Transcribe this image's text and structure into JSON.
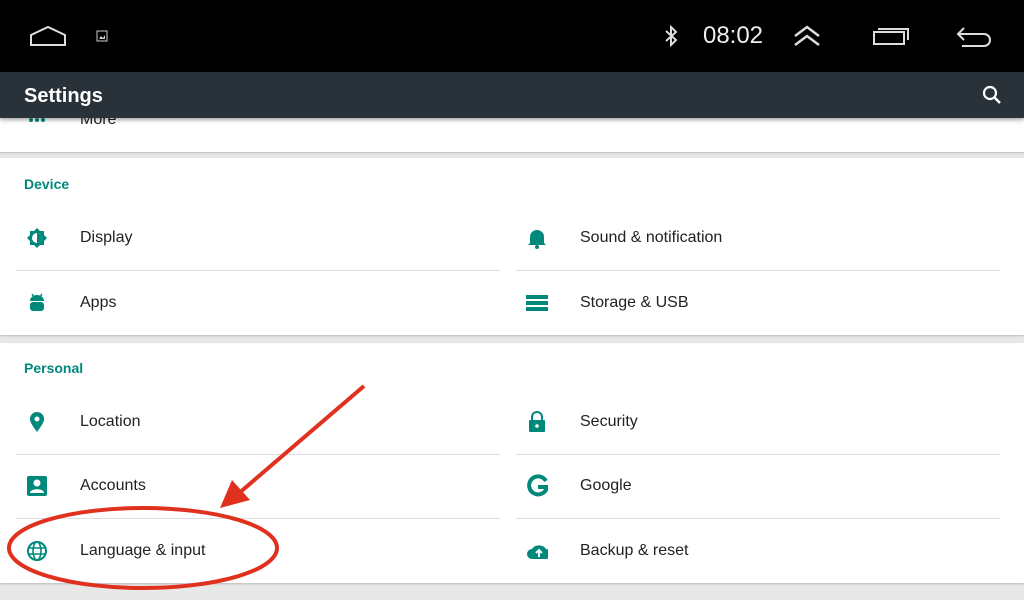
{
  "status_bar": {
    "time": "08:02",
    "icons": [
      "home-icon",
      "image-notification-icon",
      "bluetooth-icon",
      "expand-up-icon",
      "recent-apps-icon",
      "back-icon"
    ]
  },
  "toolbar": {
    "title": "Settings",
    "search_icon": "search-icon"
  },
  "partial_item": {
    "label": "More",
    "icon": "more-dots-icon"
  },
  "sections": [
    {
      "header": "Device",
      "items": [
        {
          "label": "Display",
          "icon": "brightness-icon"
        },
        {
          "label": "Sound & notification",
          "icon": "bell-icon"
        },
        {
          "label": "Apps",
          "icon": "android-icon"
        },
        {
          "label": "Storage & USB",
          "icon": "storage-icon"
        }
      ]
    },
    {
      "header": "Personal",
      "items": [
        {
          "label": "Location",
          "icon": "location-pin-icon"
        },
        {
          "label": "Security",
          "icon": "lock-icon"
        },
        {
          "label": "Accounts",
          "icon": "account-icon"
        },
        {
          "label": "Google",
          "icon": "google-g-icon"
        },
        {
          "label": "Language & input",
          "icon": "globe-icon"
        },
        {
          "label": "Backup & reset",
          "icon": "cloud-upload-icon"
        }
      ]
    }
  ],
  "colors": {
    "accent": "#00897b",
    "toolbar": "#283238",
    "annotation": "#e0301e"
  },
  "annotation": {
    "type": "arrow-and-circle",
    "target": "Language & input"
  }
}
